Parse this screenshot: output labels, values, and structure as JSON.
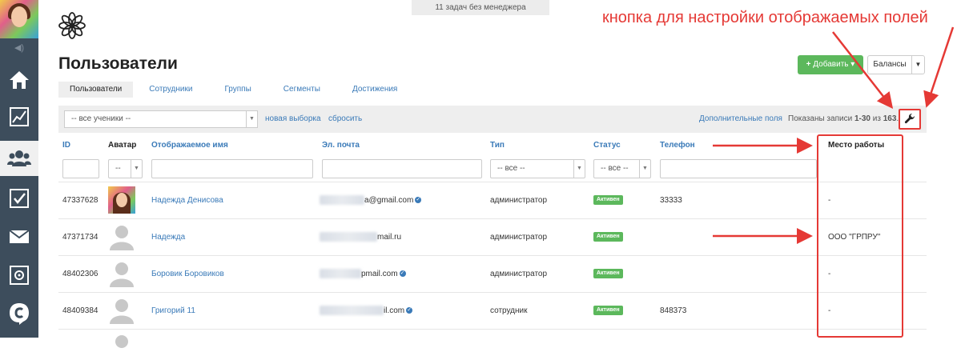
{
  "banner": "11 задач без менеджера",
  "annotation": "кнопка для настройки отображаемых полей",
  "page_title": "Пользователи",
  "buttons": {
    "add": "Добавить",
    "balances": "Балансы"
  },
  "tabs": [
    {
      "label": "Пользователи",
      "active": true
    },
    {
      "label": "Сотрудники"
    },
    {
      "label": "Группы"
    },
    {
      "label": "Сегменты"
    },
    {
      "label": "Достижения"
    }
  ],
  "filterbar": {
    "students_select": "-- все ученики --",
    "new_selection": "новая выборка",
    "reset": "сбросить",
    "extra_fields": "Дополнительные поля",
    "shown_prefix": "Показаны записи",
    "shown_range": "1-30",
    "shown_of": "из",
    "shown_total": "163"
  },
  "columns": [
    "ID",
    "Аватар",
    "Отображаемое имя",
    "Эл. почта",
    "Тип",
    "Статус",
    "Телефон",
    "Место работы"
  ],
  "filters": {
    "avatar_select": "--",
    "type_select": "-- все --",
    "status_select": "-- все --"
  },
  "rows": [
    {
      "id": "47337628",
      "name": "Надежда Денисова",
      "email": "a@gmail.com",
      "verified": true,
      "type": "администратор",
      "status": "Активен",
      "phone": "33333",
      "work": "-",
      "avatar": "photo"
    },
    {
      "id": "47371734",
      "name": "Надежда",
      "email": "mail.ru",
      "verified": false,
      "type": "администратор",
      "status": "Активен",
      "phone": "",
      "work": "ООО \"ГРПРУ\"",
      "avatar": "placeholder"
    },
    {
      "id": "48402306",
      "name": "Боровик Боровиков",
      "email": "pmail.com",
      "verified": true,
      "type": "администратор",
      "status": "Активен",
      "phone": "",
      "work": "-",
      "avatar": "placeholder"
    },
    {
      "id": "48409384",
      "name": "Григорий 11",
      "email": "il.com",
      "verified": true,
      "type": "сотрудник",
      "status": "Активен",
      "phone": "848373",
      "work": "-",
      "avatar": "placeholder"
    }
  ],
  "colors": {
    "accent": "#3a7ab8",
    "success": "#5cb85c",
    "annotation": "#e53935",
    "sidebar": "#3d4d5c"
  },
  "icons": [
    "speaker-icon",
    "home-icon",
    "chart-icon",
    "users-icon",
    "tasks-icon",
    "mail-icon",
    "safe-icon",
    "brand-icon",
    "wrench-icon",
    "verified-icon"
  ]
}
